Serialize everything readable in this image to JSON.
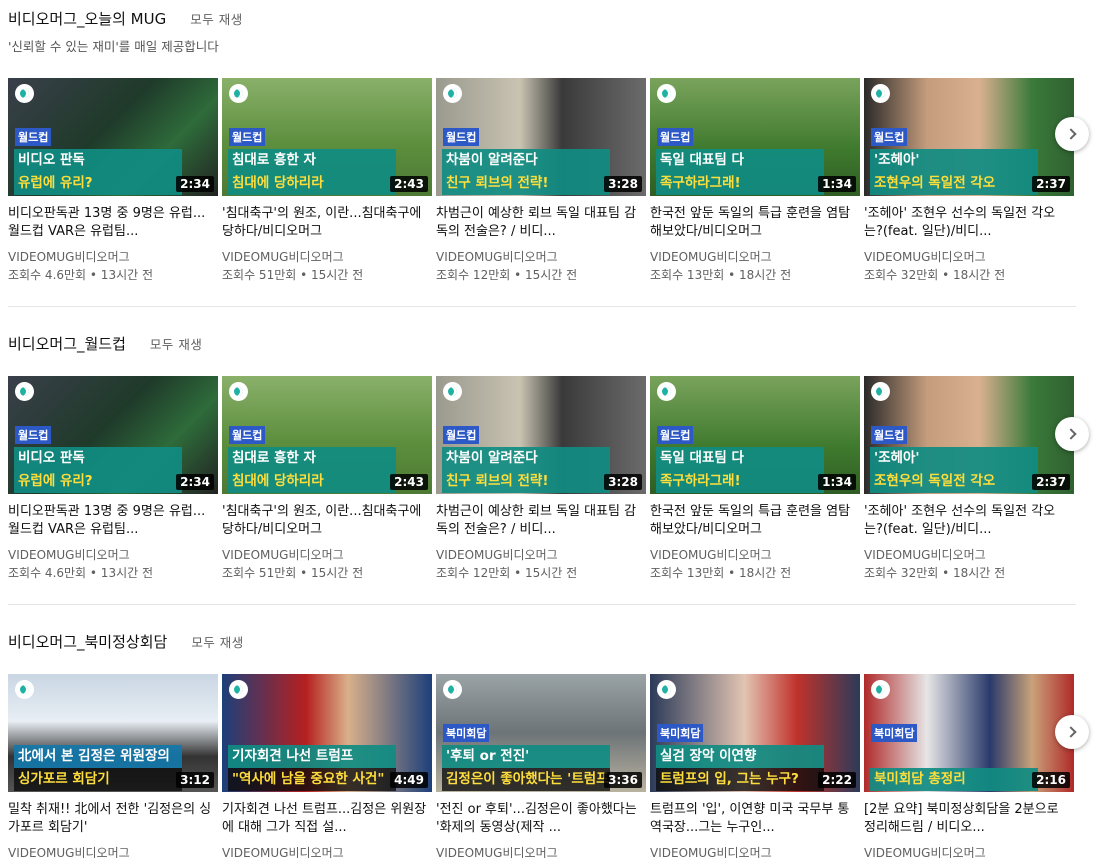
{
  "shelves": [
    {
      "title": "비디오머그_오늘의 MUG",
      "play_all": "모두 재생",
      "description": "'신뢰할 수 있는 재미'를 매일 제공합니다",
      "videos": [
        {
          "category": "월드컵",
          "cap1": "비디오 판독",
          "cap2": "유럽에 유리?",
          "duration": "2:34",
          "title": "비디오판독관 13명 중 9명은 유럽...월드컵 VAR은 유럽팀...",
          "channel": "VIDEOMUG비디오머그",
          "stats": "조회수 4.6만회 • 13시간 전",
          "icon": "video-mug-logo-icon"
        },
        {
          "category": "월드컵",
          "cap1": "침대로 흥한 자",
          "cap2": "침대에 당하리라",
          "duration": "2:43",
          "title": "'침대축구'의 원조, 이란...침대축구에 당하다/비디오머그",
          "channel": "VIDEOMUG비디오머그",
          "stats": "조회수 51만회 • 15시간 전",
          "icon": "video-mug-logo-icon"
        },
        {
          "category": "월드컵",
          "cap1": "차붐이 알려준다",
          "cap2": "친구 뢰브의 전략!",
          "duration": "3:28",
          "title": "차범근이 예상한 뢰브 독일 대표팀 감독의 전술은? / 비디...",
          "channel": "VIDEOMUG비디오머그",
          "stats": "조회수 12만회 • 15시간 전",
          "icon": "video-mug-logo-icon"
        },
        {
          "category": "월드컵",
          "cap1": "독일 대표팀 다",
          "cap2": "족구하라그래!",
          "duration": "1:34",
          "title": "한국전 앞둔 독일의 특급 훈련을 염탐해보았다/비디오머그",
          "channel": "VIDEOMUG비디오머그",
          "stats": "조회수 13만회 • 18시간 전",
          "icon": "video-mug-logo-icon"
        },
        {
          "category": "월드컵",
          "cap1": "'조헤아'",
          "cap2": "조현우의 독일전 각오",
          "duration": "2:37",
          "title": "'조헤아' 조현우 선수의 독일전 각오는?(feat. 일단)/비디...",
          "channel": "VIDEOMUG비디오머그",
          "stats": "조회수 32만회 • 18시간 전",
          "icon": "video-mug-logo-icon"
        }
      ]
    },
    {
      "title": "비디오머그_월드컵",
      "play_all": "모두 재생",
      "description": "",
      "videos": [
        {
          "category": "월드컵",
          "cap1": "비디오 판독",
          "cap2": "유럽에 유리?",
          "duration": "2:34",
          "title": "비디오판독관 13명 중 9명은 유럽...월드컵 VAR은 유럽팀...",
          "channel": "VIDEOMUG비디오머그",
          "stats": "조회수 4.6만회 • 13시간 전",
          "icon": "video-mug-logo-icon"
        },
        {
          "category": "월드컵",
          "cap1": "침대로 흥한 자",
          "cap2": "침대에 당하리라",
          "duration": "2:43",
          "title": "'침대축구'의 원조, 이란...침대축구에 당하다/비디오머그",
          "channel": "VIDEOMUG비디오머그",
          "stats": "조회수 51만회 • 15시간 전",
          "icon": "video-mug-logo-icon"
        },
        {
          "category": "월드컵",
          "cap1": "차붐이 알려준다",
          "cap2": "친구 뢰브의 전략!",
          "duration": "3:28",
          "title": "차범근이 예상한 뢰브 독일 대표팀 감독의 전술은? / 비디...",
          "channel": "VIDEOMUG비디오머그",
          "stats": "조회수 12만회 • 15시간 전",
          "icon": "video-mug-logo-icon"
        },
        {
          "category": "월드컵",
          "cap1": "독일 대표팀 다",
          "cap2": "족구하라그래!",
          "duration": "1:34",
          "title": "한국전 앞둔 독일의 특급 훈련을 염탐해보았다/비디오머그",
          "channel": "VIDEOMUG비디오머그",
          "stats": "조회수 13만회 • 18시간 전",
          "icon": "video-mug-logo-icon"
        },
        {
          "category": "월드컵",
          "cap1": "'조헤아'",
          "cap2": "조현우의 독일전 각오",
          "duration": "2:37",
          "title": "'조헤아' 조현우 선수의 독일전 각오는?(feat. 일단)/비디...",
          "channel": "VIDEOMUG비디오머그",
          "stats": "조회수 32만회 • 18시간 전",
          "icon": "video-mug-logo-icon"
        }
      ]
    },
    {
      "title": "비디오머그_북미정상회담",
      "play_all": "모두 재생",
      "description": "",
      "videos": [
        {
          "category": "",
          "cap1": "北에서 본 김정은 위원장의",
          "cap2": "싱가포르 회담기",
          "duration": "3:12",
          "title": "밀착 취재!! 北에서 전한 '김정은의 싱가포르 회담기'",
          "channel": "VIDEOMUG비디오머그",
          "stats": "",
          "icon": "video-mug-logo-icon"
        },
        {
          "category": "",
          "cap1": "기자회견 나선 트럼프",
          "cap2": "\"역사에 남을 중요한 사건\"",
          "duration": "4:49",
          "title": "기자회견 나선 트럼프...김정은 위원장에 대해 그가 직접 설...",
          "channel": "VIDEOMUG비디오머그",
          "stats": "",
          "icon": "video-mug-logo-icon"
        },
        {
          "category": "북미회담",
          "cap1": "'후퇴 or 전진'",
          "cap2": "김정은이 좋아했다는 '트럼프 영상'",
          "duration": "3:36",
          "title": "'전진 or 후퇴'...김정은이 좋아했다는 '화제의 동영상(제작 ...",
          "channel": "VIDEOMUG비디오머그",
          "stats": "",
          "icon": "video-mug-logo-icon"
        },
        {
          "category": "북미회담",
          "cap1": "실검 장악 이연향",
          "cap2": "트럼프의 입, 그는 누구?",
          "duration": "2:22",
          "title": "트럼프의 '입', 이연향 미국 국무부 통역국장...그는 누구인...",
          "channel": "VIDEOMUG비디오머그",
          "stats": "",
          "icon": "video-mug-logo-icon"
        },
        {
          "category": "북미회담",
          "cap1": "북미회담 총정리",
          "cap2": "",
          "duration": "2:16",
          "title": "[2분 요약] 북미정상회담을 2분으로 정리해드림 / 비디오...",
          "channel": "VIDEOMUG비디오머그",
          "stats": "",
          "icon": "video-mug-logo-icon"
        }
      ]
    }
  ],
  "next_arrow_icon": "chevron-right-icon",
  "colors": {
    "caption_teal": "#108c82",
    "category_blue": "#2d59c6",
    "accent_yellow": "#ffde3b",
    "meta_gray": "#606060"
  }
}
